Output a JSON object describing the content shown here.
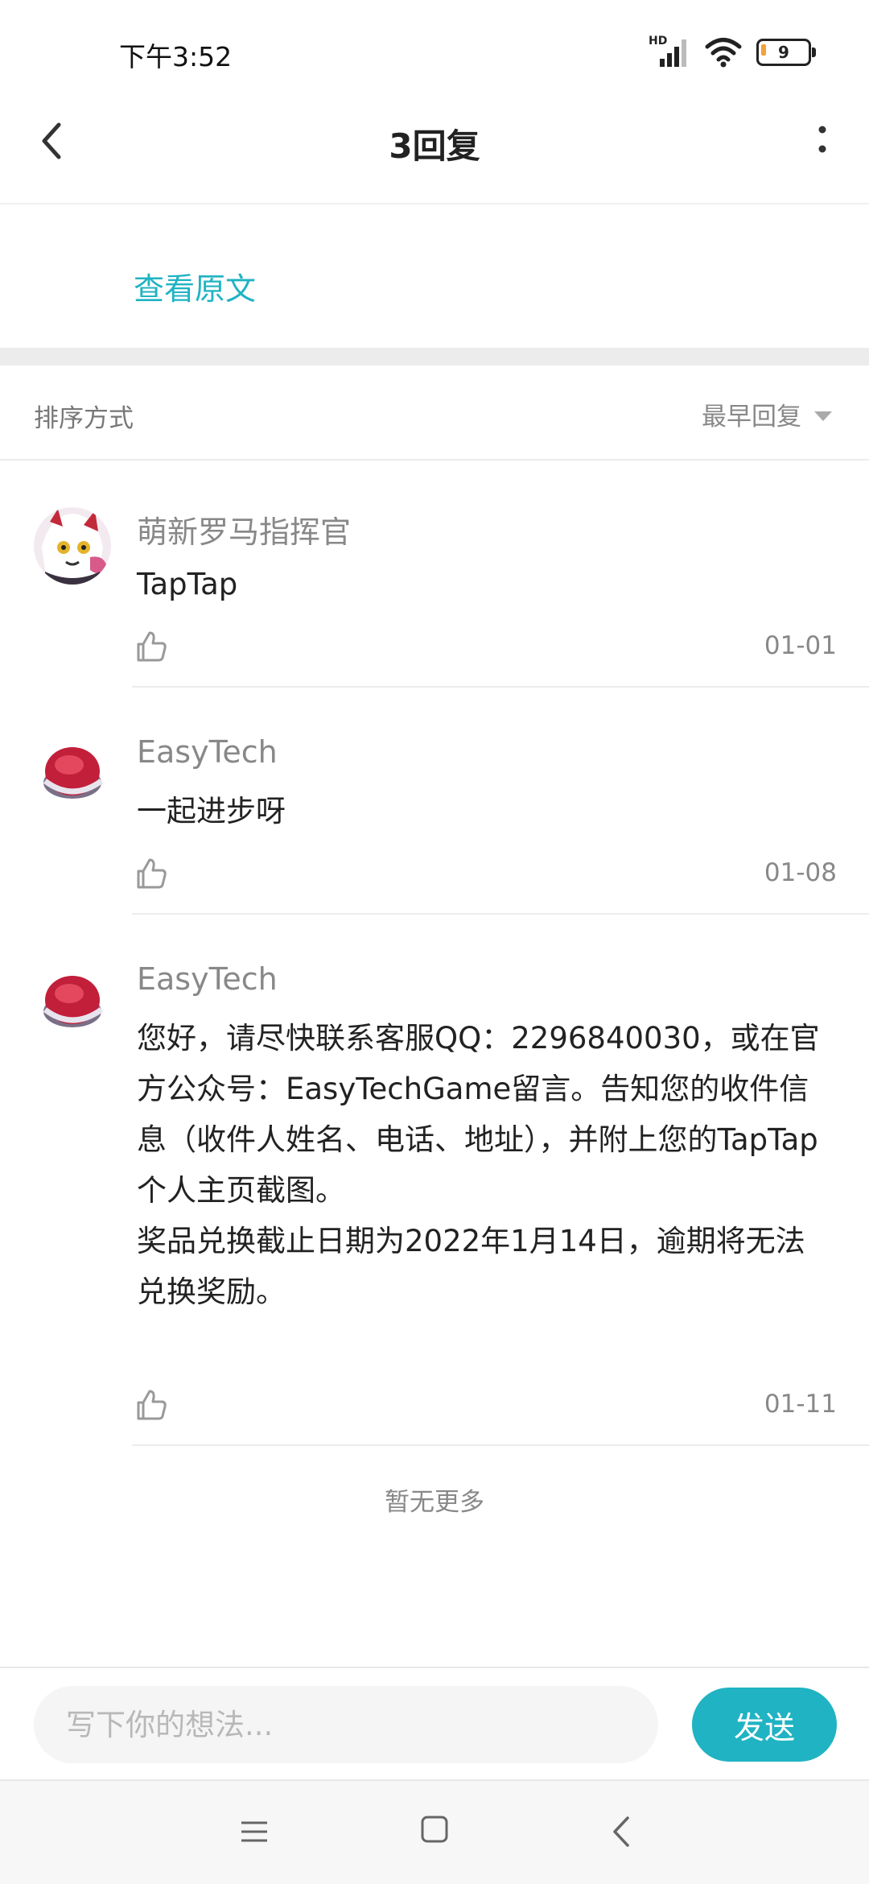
{
  "status_bar": {
    "time": "下午3:52",
    "signal_label": "HD",
    "battery_level": "9",
    "icons": [
      "signal-icon",
      "wifi-icon",
      "battery-icon"
    ]
  },
  "header": {
    "title": "3回复",
    "back_icon": "chevron-left-icon",
    "more_icon": "more-vertical-icon"
  },
  "original_link": "查看原文",
  "sort": {
    "label": "排序方式",
    "selected": "最早回复"
  },
  "replies": [
    {
      "author": "萌新罗马指挥官",
      "content": "TapTap",
      "date": "01-01"
    },
    {
      "author": "EasyTech",
      "content": "一起进步呀",
      "date": "01-08"
    },
    {
      "author": "EasyTech",
      "content": "您好，请尽快联系客服QQ：2296840030，或在官方公众号：EasyTechGame留言。告知您的收件信息（收件人姓名、电话、地址），并附上您的TapTap个人主页截图。\n奖品兑换截止日期为2022年1月14日，逾期将无法兑换奖励。",
      "date": "01-11"
    }
  ],
  "no_more": "暂无更多",
  "composer": {
    "placeholder": "写下你的想法...",
    "send_label": "发送"
  },
  "colors": {
    "accent": "#1fb3c3",
    "divider": "#ececec",
    "muted_text": "#888888"
  }
}
